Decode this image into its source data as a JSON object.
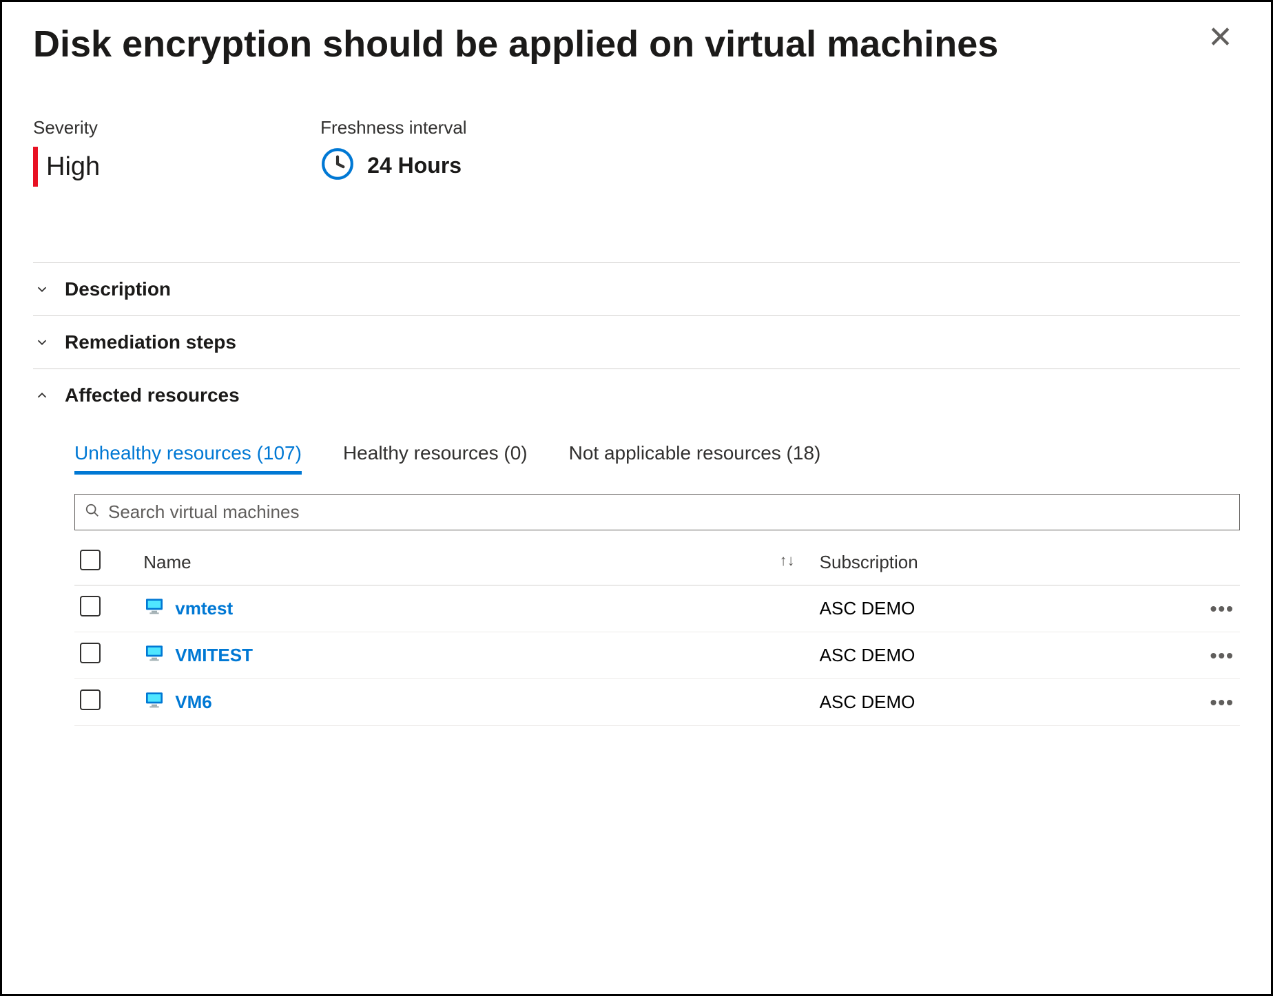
{
  "title": "Disk encryption should be applied on virtual machines",
  "meta": {
    "severity_label": "Severity",
    "severity_value": "High",
    "freshness_label": "Freshness interval",
    "freshness_value": "24 Hours"
  },
  "sections": {
    "description": "Description",
    "remediation": "Remediation steps",
    "affected": "Affected resources"
  },
  "tabs": {
    "unhealthy": "Unhealthy resources (107)",
    "healthy": "Healthy resources (0)",
    "notapplicable": "Not applicable resources (18)"
  },
  "search": {
    "placeholder": "Search virtual machines"
  },
  "table": {
    "headers": {
      "name": "Name",
      "subscription": "Subscription"
    },
    "rows": [
      {
        "name": "vmtest",
        "subscription": "ASC DEMO"
      },
      {
        "name": "VMITEST",
        "subscription": "ASC DEMO"
      },
      {
        "name": "VM6",
        "subscription": "ASC DEMO"
      }
    ]
  }
}
